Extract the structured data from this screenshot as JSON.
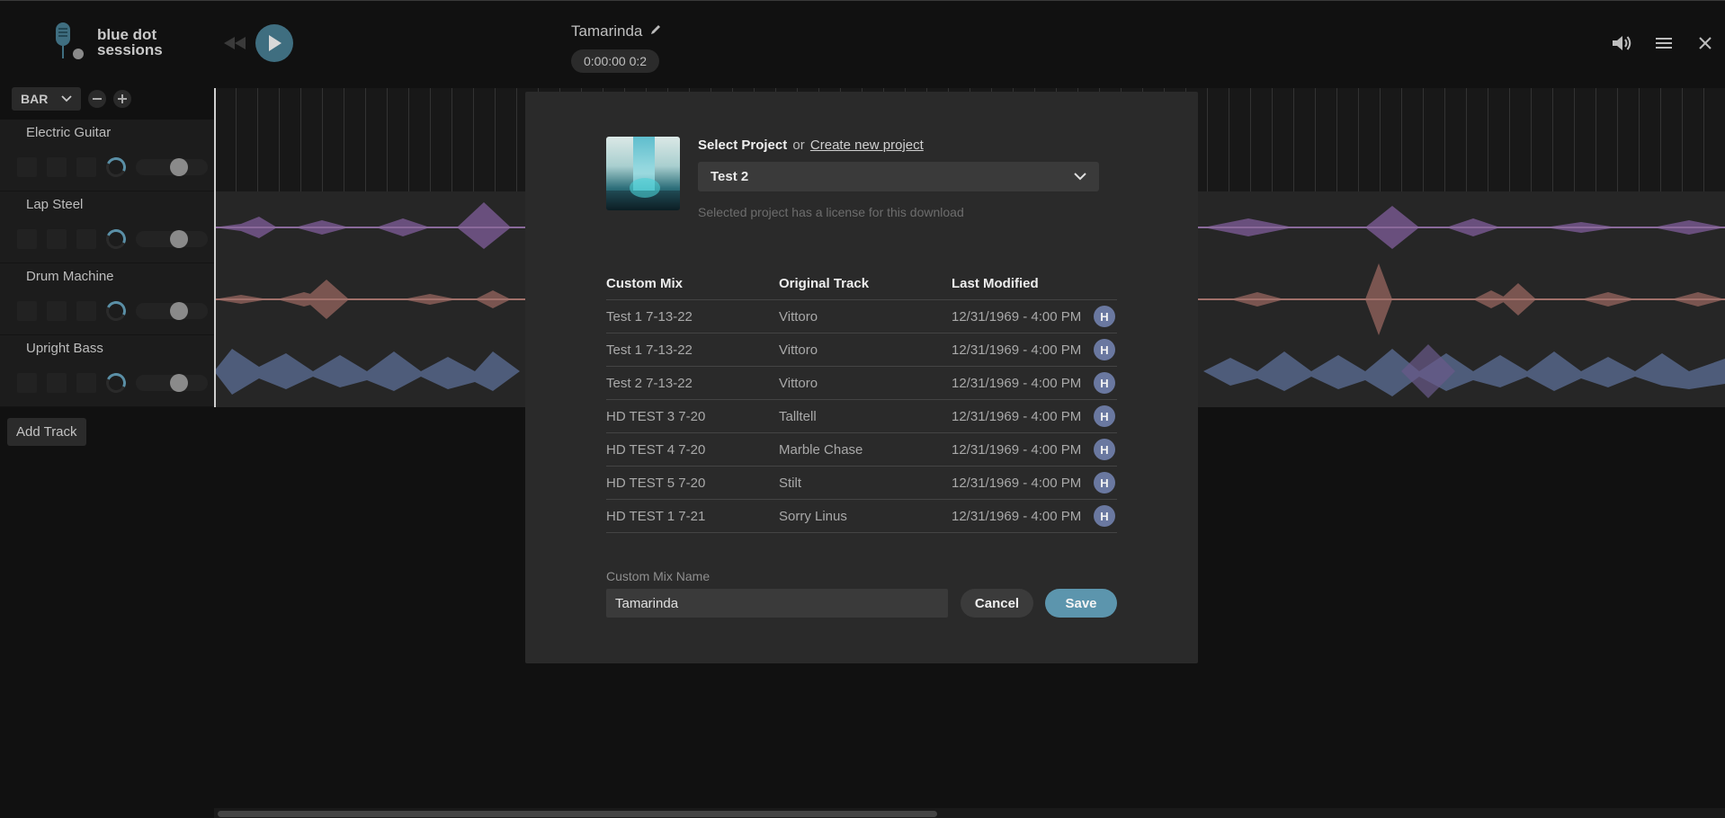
{
  "brand": {
    "line1": "blue dot",
    "line2": "sessions"
  },
  "header": {
    "title": "Tamarinda",
    "time": "0:00:00 0:2"
  },
  "grid": {
    "unit": "BAR"
  },
  "tracks": [
    {
      "name": "Electric Guitar",
      "color": "#8a6a9a"
    },
    {
      "name": "Lap Steel",
      "color": "#8a6a9a"
    },
    {
      "name": "Drum Machine",
      "color": "#a0706a"
    },
    {
      "name": "Upright Bass",
      "color": "#6a7ea0"
    }
  ],
  "add_track_label": "Add Track",
  "modal": {
    "select_project": "Select Project",
    "or": "or",
    "create_new": "Create new project",
    "selected_project": "Test 2",
    "license_note": "Selected project has a license for this download",
    "columns": [
      "Custom Mix",
      "Original Track",
      "Last Modified"
    ],
    "rows": [
      {
        "mix": "Test 1 7-13-22",
        "track": "Vittoro",
        "modified": "12/31/1969 - 4:00 PM",
        "badge": "H"
      },
      {
        "mix": "Test 1 7-13-22",
        "track": "Vittoro",
        "modified": "12/31/1969 - 4:00 PM",
        "badge": "H"
      },
      {
        "mix": "Test 2 7-13-22",
        "track": "Vittoro",
        "modified": "12/31/1969 - 4:00 PM",
        "badge": "H"
      },
      {
        "mix": "HD TEST 3 7-20",
        "track": "Talltell",
        "modified": "12/31/1969 - 4:00 PM",
        "badge": "H"
      },
      {
        "mix": "HD TEST 4 7-20",
        "track": "Marble Chase",
        "modified": "12/31/1969 - 4:00 PM",
        "badge": "H"
      },
      {
        "mix": "HD TEST 5 7-20",
        "track": "Stilt",
        "modified": "12/31/1969 - 4:00 PM",
        "badge": "H"
      },
      {
        "mix": "HD TEST 1 7-21",
        "track": "Sorry Linus",
        "modified": "12/31/1969 - 4:00 PM",
        "badge": "H"
      }
    ],
    "name_label": "Custom Mix Name",
    "name_value": "Tamarinda",
    "cancel_label": "Cancel",
    "save_label": "Save"
  },
  "colors": {
    "accent": "#5c95ad",
    "badge": "#6a78a0"
  }
}
